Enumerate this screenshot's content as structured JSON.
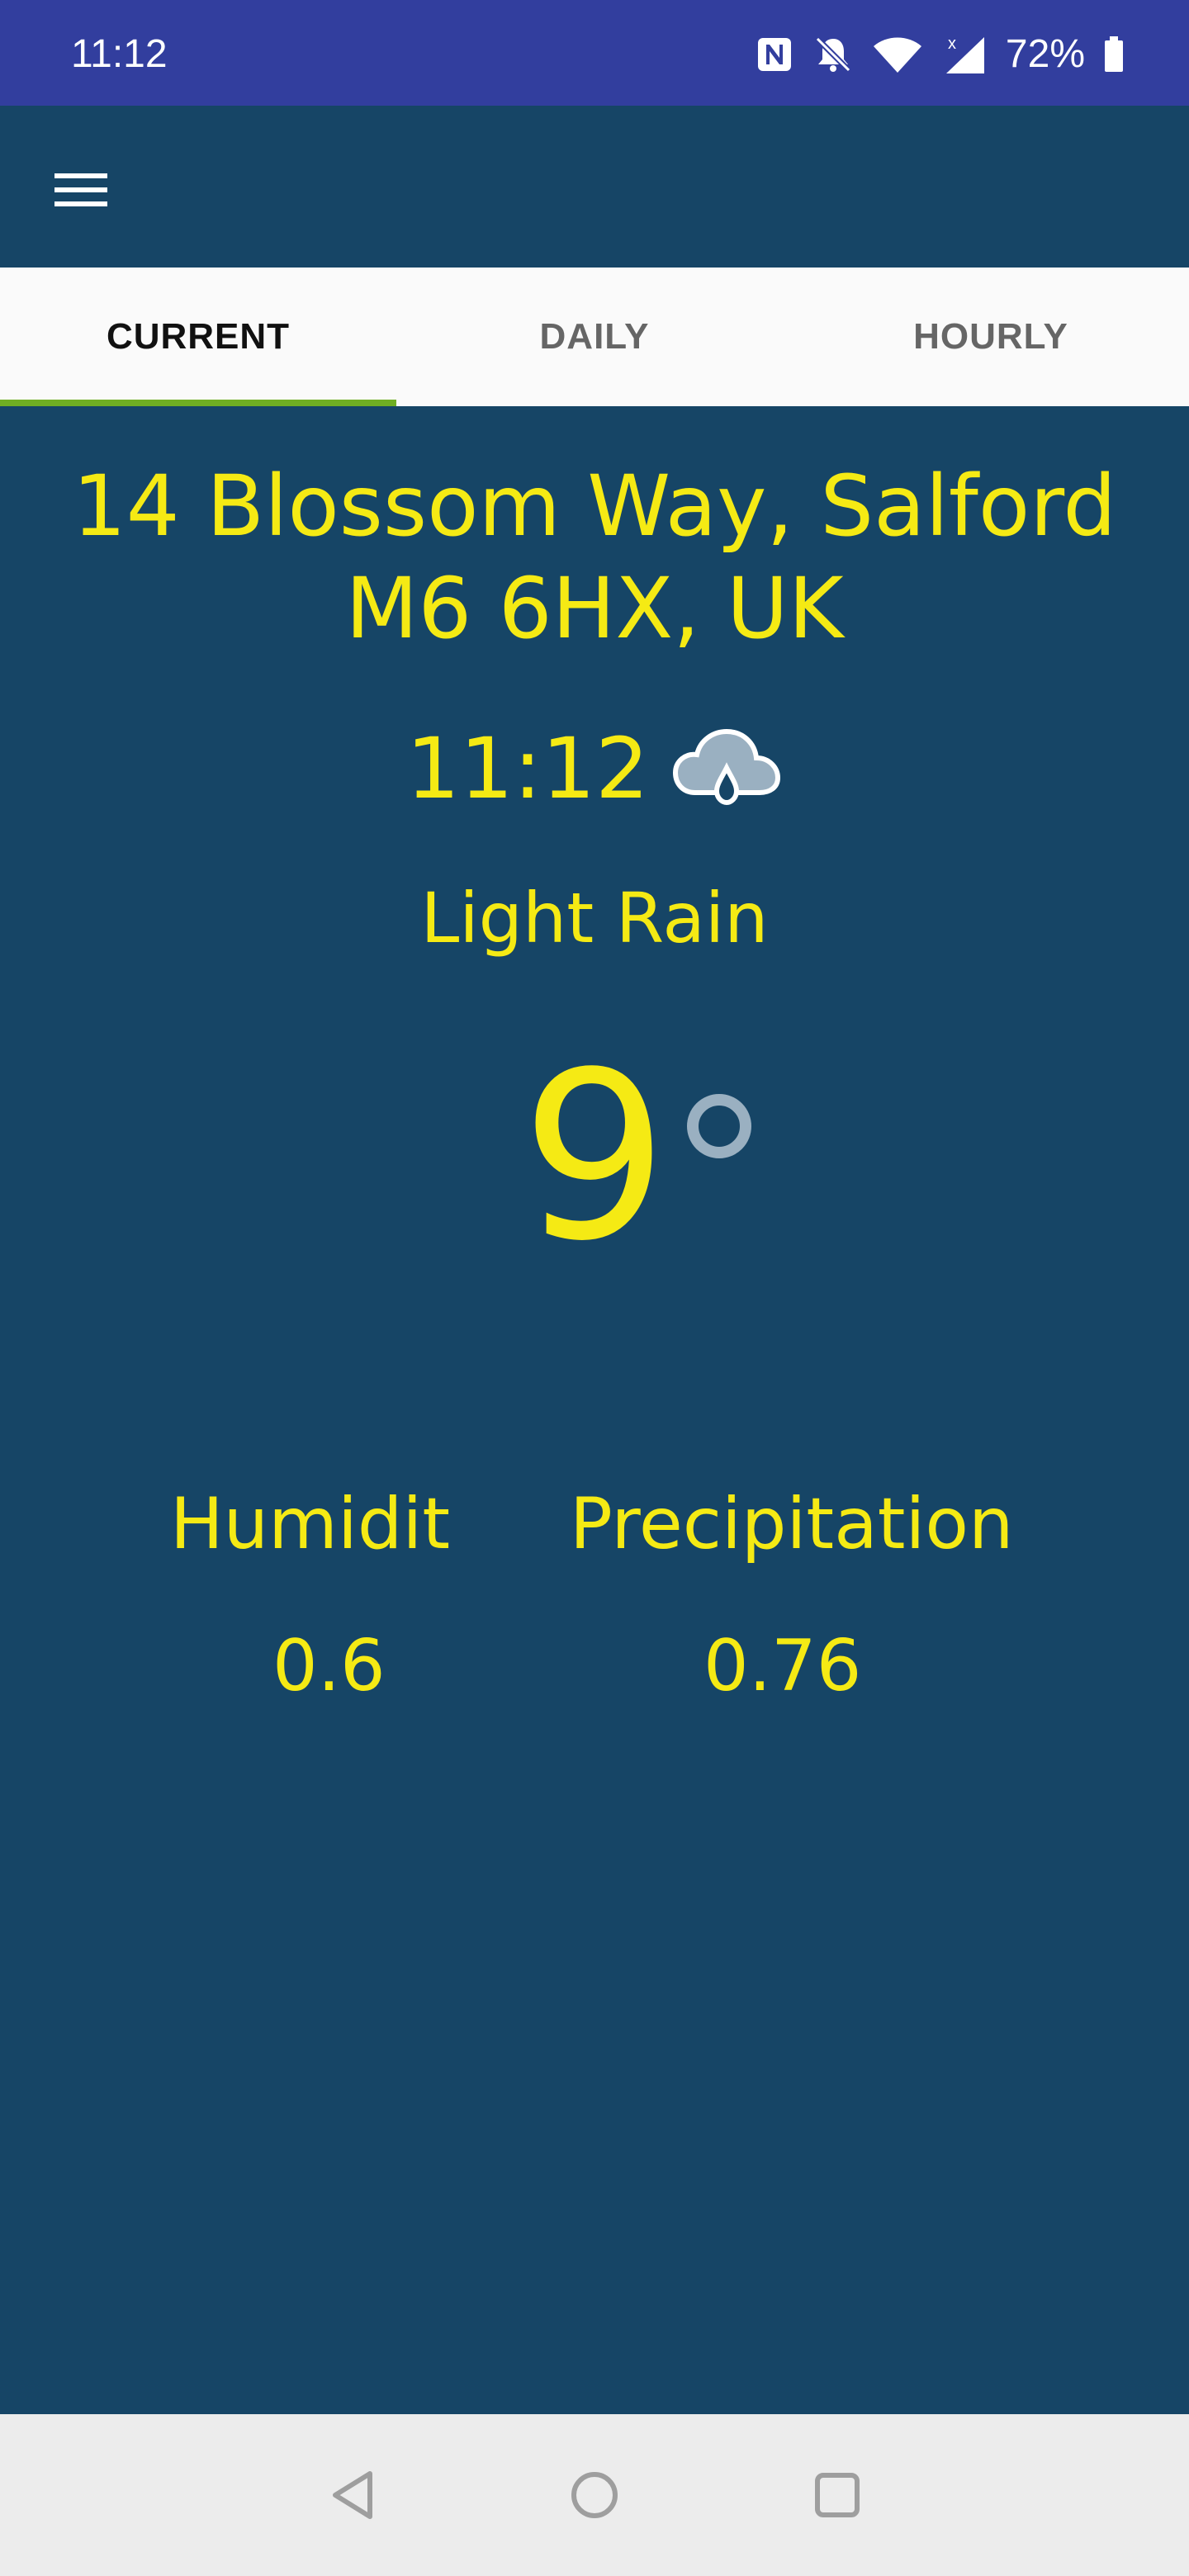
{
  "status_bar": {
    "time": "11:12",
    "battery_percent": "72%",
    "icons": [
      "nfc-icon",
      "notifications-muted-icon",
      "wifi-icon",
      "signal-icon",
      "battery-icon"
    ]
  },
  "toolbar": {
    "menu_icon": "hamburger-menu-icon"
  },
  "tabs": [
    {
      "label": "CURRENT",
      "active": true
    },
    {
      "label": "DAILY",
      "active": false
    },
    {
      "label": "HOURLY",
      "active": false
    }
  ],
  "weather": {
    "address": "14 Blossom Way, Salford M6 6HX, UK",
    "time": "11:12",
    "condition_icon": "cloud-rain-icon",
    "condition": "Light Rain",
    "temperature": "9",
    "humidity_label": "Humidit",
    "humidity_value": "0.6",
    "precipitation_label": "Precipitation",
    "precipitation_value": "0.76"
  },
  "colors": {
    "status_bar": "#323e9e",
    "background": "#164566",
    "accent_text": "#f5ea14",
    "tab_indicator": "#6fae23",
    "icon_gray": "#9ab0c1"
  },
  "nav_bar": {
    "icons": [
      "back-icon",
      "home-icon",
      "recents-icon"
    ]
  }
}
